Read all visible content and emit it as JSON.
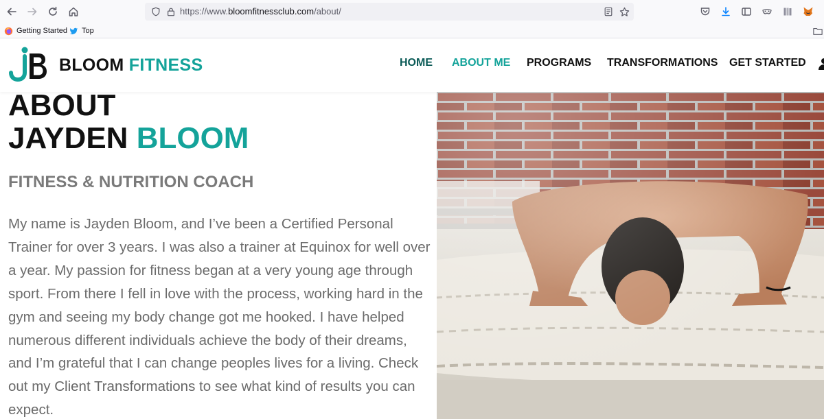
{
  "browser": {
    "url_prefix": "https://www.",
    "url_host": "bloomfitnessclub.com",
    "url_path": "/about/",
    "bookmarks": [
      {
        "label": "Getting Started",
        "icon": "firefox-icon"
      },
      {
        "label": "Top",
        "icon": "twitter-icon"
      }
    ]
  },
  "site": {
    "logo_initials": "JB",
    "brand_main": "BLOOM",
    "brand_accent": "FITNESS",
    "nav": [
      "HOME",
      "ABOUT ME",
      "PROGRAMS",
      "TRANSFORMATIONS",
      "GET STARTED"
    ],
    "active_nav": "ABOUT ME"
  },
  "about": {
    "heading_line1": "ABOUT",
    "heading_name": "JAYDEN",
    "heading_accent": "BLOOM",
    "subtitle": "FITNESS & NUTRITION COACH",
    "bio_before_link": "My name is Jayden Bloom, and I’ve been a Certified Personal Trainer for over 3 years. I was also a trainer at Equinox for well over a year. My passion for fitness began at a very young age through sport. From there I fell in love with the process, working hard in the gym and seeing my body change got me hooked. I have helped numerous different individuals achieve the body of their dreams, and I’m grateful that I can change peoples lives for a living. Check out my",
    "bio_link": "Client Transformations",
    "bio_after_link": "to see what kind of results you can expect."
  },
  "colors": {
    "accent": "#14a39a",
    "home_nav": "#0a5a56",
    "text_dark": "#111111",
    "text_grey": "#6b6b6b"
  }
}
